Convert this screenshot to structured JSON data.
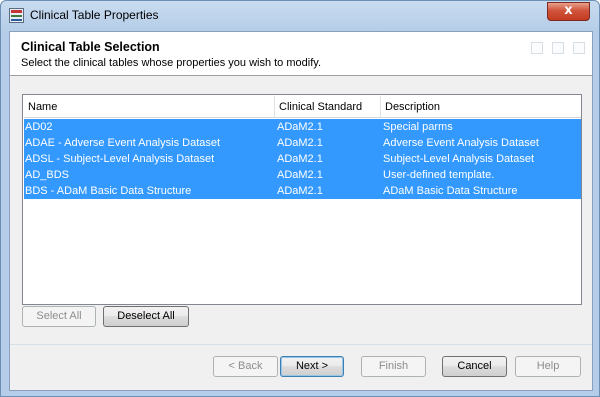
{
  "window": {
    "title": "Clinical Table Properties",
    "close_label": "x"
  },
  "header": {
    "title": "Clinical Table Selection",
    "subtitle": "Select the clinical tables whose properties you wish to modify."
  },
  "table": {
    "columns": [
      "Name",
      "Clinical Standard",
      "Description"
    ],
    "rows": [
      {
        "name": "AD02",
        "standard": "ADaM2.1",
        "description": "Special parms",
        "selected": true
      },
      {
        "name": "ADAE - Adverse Event Analysis Dataset",
        "standard": "ADaM2.1",
        "description": "Adverse Event Analysis Dataset",
        "selected": true
      },
      {
        "name": "ADSL - Subject-Level Analysis Dataset",
        "standard": "ADaM2.1",
        "description": "Subject-Level Analysis Dataset",
        "selected": true
      },
      {
        "name": "AD_BDS",
        "standard": "ADaM2.1",
        "description": "User-defined template.",
        "selected": true
      },
      {
        "name": "BDS - ADaM Basic Data Structure",
        "standard": "ADaM2.1",
        "description": "ADaM Basic Data Structure",
        "selected": true
      }
    ]
  },
  "selection_buttons": {
    "select_all": "Select All",
    "deselect_all": "Deselect All"
  },
  "footer": {
    "back": "< Back",
    "next": "Next >",
    "finish": "Finish",
    "cancel": "Cancel",
    "help": "Help"
  },
  "colors": {
    "selection": "#3399ff",
    "title_bar": "#b5cde8",
    "close_button": "#c9442b"
  }
}
